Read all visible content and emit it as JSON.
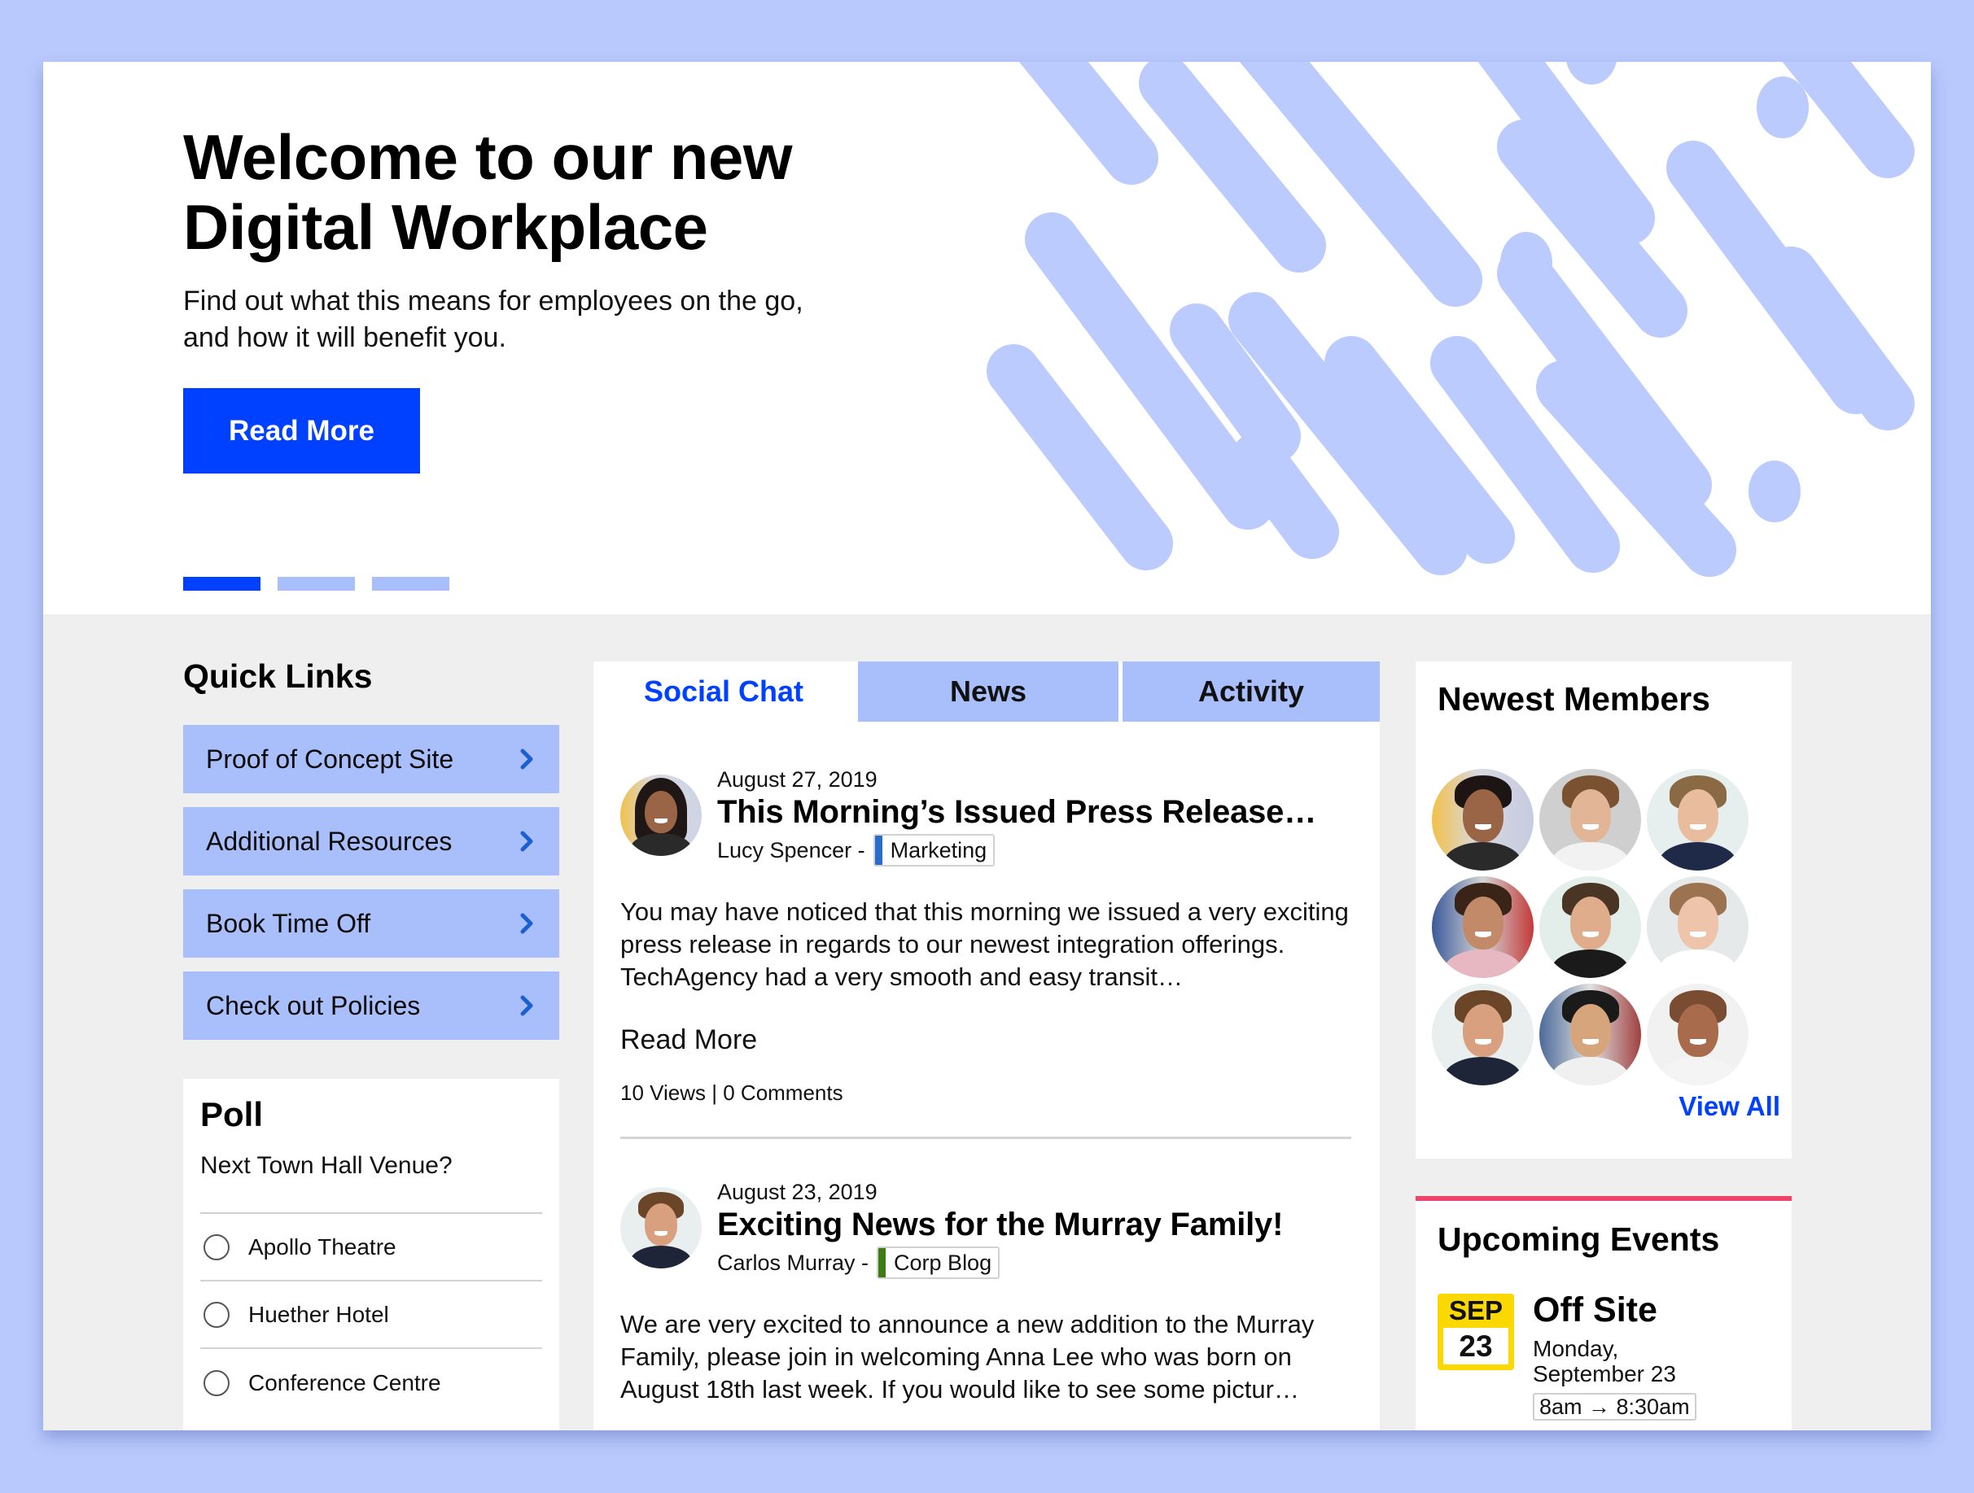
{
  "colors": {
    "page_bg": "#b9c9fd",
    "accent_blue": "#0040ff",
    "light_blue": "#a8bffc",
    "pattern_blue": "#bccbfd",
    "events_accent": "#f0436a",
    "calendar_yellow": "#fad800",
    "tag_marketing": "#2a6ccd",
    "tag_corp_blog": "#3f7a12"
  },
  "hero": {
    "title_line1": "Welcome to our new",
    "title_line2": "Digital Workplace",
    "subtitle_line1": "Find out what this means for employees on the go,",
    "subtitle_line2": "and how it will benefit you.",
    "button_label": "Read More",
    "slides_total": 3,
    "active_slide": 1
  },
  "quick_links": {
    "title": "Quick Links",
    "items": [
      {
        "label": "Proof of Concept Site",
        "icon": "chevron-right-icon"
      },
      {
        "label": "Additional Resources",
        "icon": "chevron-right-icon"
      },
      {
        "label": "Book Time Off",
        "icon": "chevron-right-icon"
      },
      {
        "label": "Check out Policies",
        "icon": "chevron-right-icon"
      }
    ]
  },
  "poll": {
    "title": "Poll",
    "question": "Next Town Hall Venue?",
    "options": [
      "Apollo Theatre",
      "Huether Hotel",
      "Conference Centre"
    ]
  },
  "feed": {
    "tabs": [
      {
        "label": "Social Chat",
        "active": true
      },
      {
        "label": "News",
        "active": false
      },
      {
        "label": "Activity",
        "active": false
      }
    ],
    "posts": [
      {
        "date": "August 27, 2019",
        "title": "This Morning’s Issued Press Release…",
        "author": "Lucy Spencer -",
        "tag": "Marketing",
        "body": "You may have noticed that this morning we issued a very exciting press release in regards to our newest integration offerings. TechAgency had a very smooth and easy transit…",
        "read_more": "Read More",
        "stats": "10 Views | 0 Comments"
      },
      {
        "date": "August 23, 2019",
        "title": "Exciting News for the Murray Family!",
        "author": "Carlos Murray -",
        "tag": "Corp Blog",
        "body": "We are very excited to announce a new addition to the Murray Family, please join in welcoming Anna Lee who was born on August 18th last week. If you would like to see some pictur…"
      }
    ]
  },
  "members": {
    "title": "Newest Members",
    "view_all": "View All",
    "count": 9
  },
  "events": {
    "title": "Upcoming Events",
    "items": [
      {
        "month": "SEP",
        "day": "23",
        "name": "Off Site",
        "date_line1": "Monday,",
        "date_line2": "September 23",
        "time": "8am → 8:30am"
      }
    ]
  }
}
